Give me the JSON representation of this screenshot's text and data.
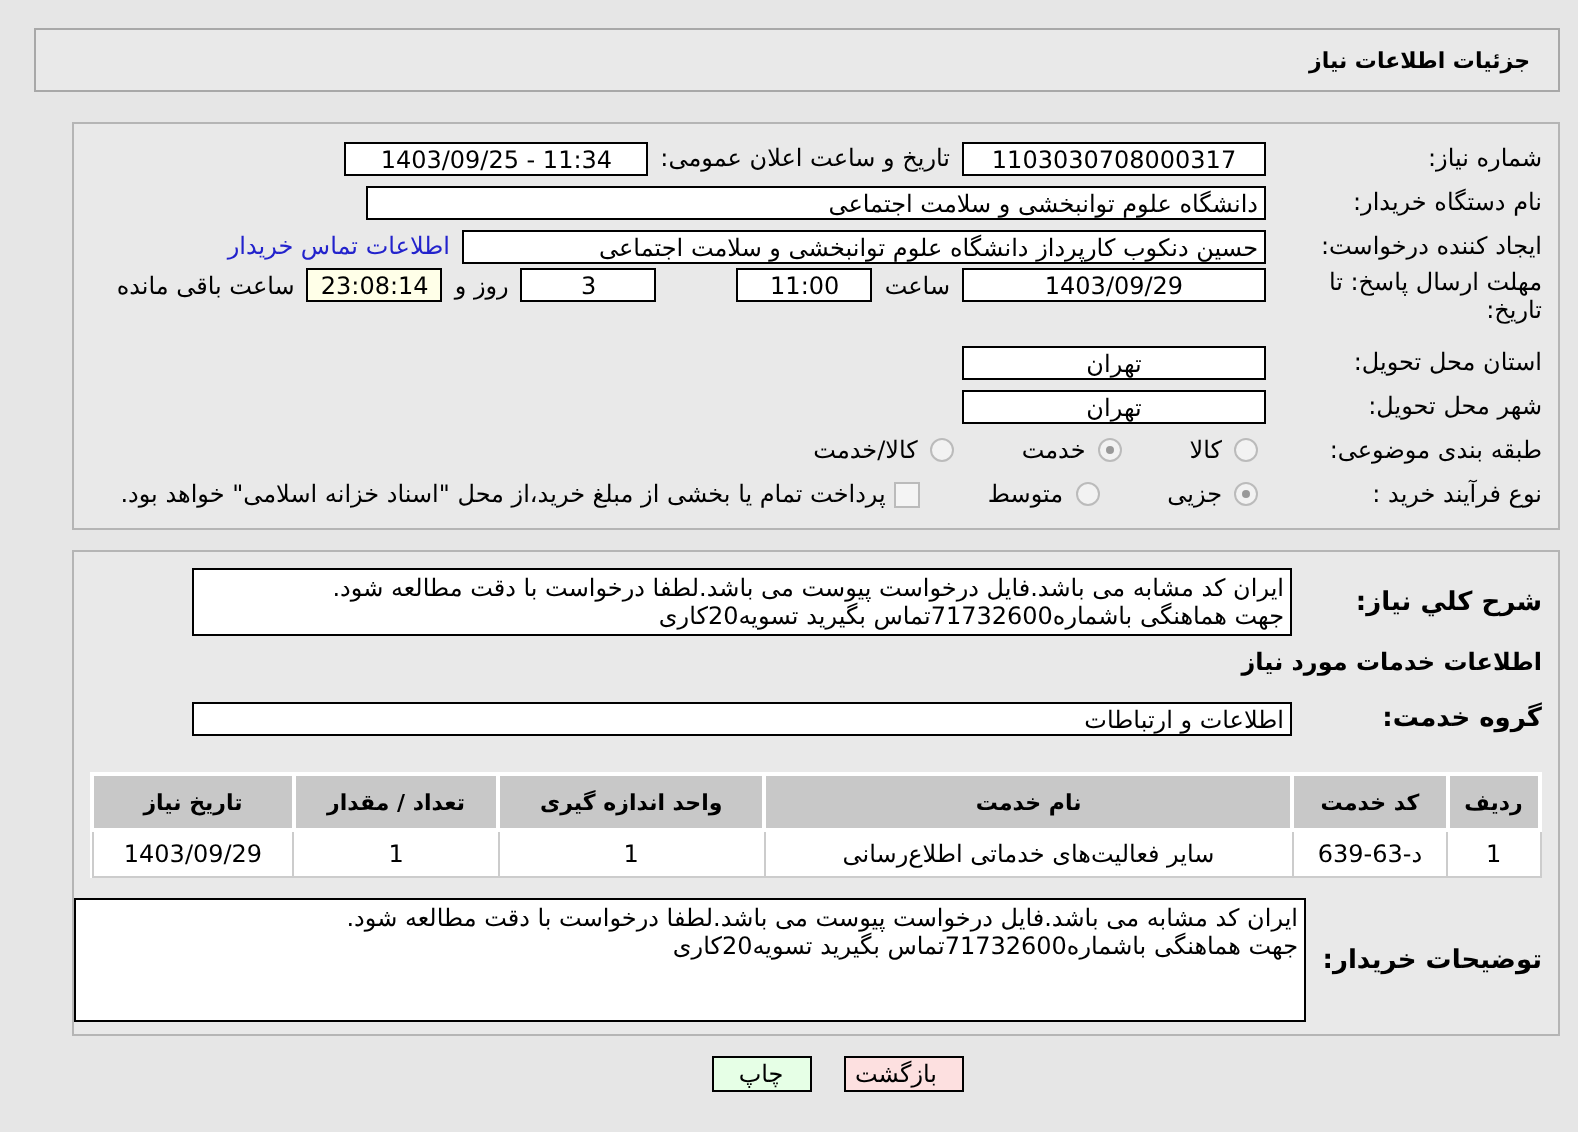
{
  "header": {
    "title": "جزئیات اطلاعات نیاز"
  },
  "details": {
    "need_number": {
      "label": "شماره نیاز:",
      "value": "1103030708000317"
    },
    "announce_date": {
      "label": "تاریخ و ساعت اعلان عمومی:",
      "value": "1403/09/25 - 11:34"
    },
    "buyer_org": {
      "label": "نام دستگاه خریدار:",
      "value": "دانشگاه علوم توانبخشی و سلامت اجتماعی"
    },
    "requester": {
      "label": "ایجاد کننده درخواست:",
      "value": "حسین دنکوب کارپرداز دانشگاه علوم توانبخشی و سلامت اجتماعی",
      "link": "اطلاعات تماس خریدار"
    },
    "deadline": {
      "label": "مهلت ارسال پاسخ: تا تاریخ:",
      "date": "1403/09/29",
      "time_label": "ساعت",
      "time": "11:00",
      "days": "3",
      "days_label": "روز و",
      "remaining": "23:08:14",
      "remaining_label": "ساعت باقی مانده"
    },
    "province": {
      "label": "استان محل تحویل:",
      "value": "تهران"
    },
    "city": {
      "label": "شهر محل تحویل:",
      "value": "تهران"
    },
    "category": {
      "label": "طبقه بندی موضوعی:",
      "options": [
        {
          "label": "کالا",
          "selected": false
        },
        {
          "label": "خدمت",
          "selected": true
        },
        {
          "label": "کالا/خدمت",
          "selected": false
        }
      ]
    },
    "process": {
      "label": "نوع فرآیند خرید :",
      "options": [
        {
          "label": "جزیی",
          "selected": true
        },
        {
          "label": "متوسط",
          "selected": false
        }
      ],
      "payment": {
        "checked": false,
        "text": "پرداخت تمام یا بخشی از مبلغ خرید،از محل \"اسناد خزانه اسلامی\" خواهد بود."
      }
    }
  },
  "services": {
    "summary": {
      "label": "شرح کلي نیاز:",
      "value": "ایران کد مشابه می باشد.فایل درخواست پیوست می باشد.لطفا درخواست با دقت مطالعه شود.\nجهت هماهنگی باشماره71732600تماس بگیرید تسویه20کاری"
    },
    "heading": "اطلاعات خدمات مورد نیاز",
    "group": {
      "label": "گروه خدمت:",
      "value": "اطلاعات و ارتباطات"
    },
    "table": {
      "columns": [
        "ردیف",
        "کد خدمت",
        "نام خدمت",
        "واحد اندازه گیری",
        "تعداد / مقدار",
        "تاریخ نیاز"
      ],
      "rows": [
        [
          "1",
          "د-63-639",
          "سایر فعالیت‌های خدماتی اطلاع‌رسانی",
          "1",
          "1",
          "1403/09/29"
        ]
      ]
    },
    "buyer_notes": {
      "label": "توضیحات خریدار:",
      "value": "ایران کد مشابه می باشد.فایل درخواست پیوست می باشد.لطفا درخواست با دقت مطالعه شود.\nجهت هماهنگی باشماره71732600تماس بگیرید تسویه20کاری"
    }
  },
  "buttons": [
    {
      "kind": "back",
      "label": "بازگشت"
    },
    {
      "kind": "print",
      "label": "چاپ"
    }
  ]
}
